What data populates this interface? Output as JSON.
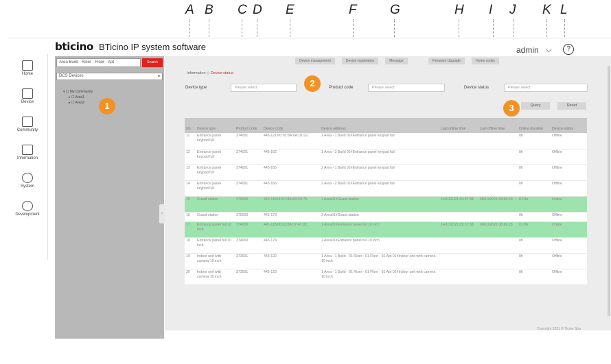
{
  "callout_letters": [
    "A",
    "B",
    "C",
    "D",
    "E",
    "F",
    "G",
    "H",
    "I",
    "J",
    "K",
    "L"
  ],
  "callout_numbers": [
    "1",
    "2",
    "3"
  ],
  "brand": {
    "logo": "bticino",
    "title": "BTicino IP system software"
  },
  "user": {
    "name": "admin",
    "chevron": "⌵",
    "help": "?"
  },
  "nav": [
    {
      "label": "Home",
      "icon": "home-icon"
    },
    {
      "label": "Device",
      "icon": "device-icon"
    },
    {
      "label": "Community",
      "icon": "community-icon"
    },
    {
      "label": "Information",
      "icon": "information-icon"
    },
    {
      "label": "System",
      "icon": "gear-icon"
    },
    {
      "label": "Development",
      "icon": "gear-icon"
    }
  ],
  "tree": {
    "search_placeholder": "Area Build - Riser - Floor - Apt",
    "search_button": "Search",
    "select_value": "DCS Devices",
    "nodes": [
      "My Community",
      "Area1",
      "Area2"
    ]
  },
  "toolbar": [
    "Device management",
    "Device registration",
    "Message",
    "Firmware Upgrade",
    "Home codes"
  ],
  "breadcrumb": {
    "parent": "Information",
    "current": "Device status"
  },
  "filters": {
    "device_type_label": "Device type",
    "device_type_value": "Please select",
    "product_code_label": "Product code",
    "product_code_value": "Please select",
    "device_status_label": "Device status",
    "device_status_value": "Please select",
    "query_button": "Query",
    "reset_button": "Reset"
  },
  "table": {
    "headers": [
      "No.",
      "Device type",
      "Product code",
      "Device code",
      "Device address",
      "Last online time",
      "Last offline time",
      "Online duration",
      "Device status"
    ],
    "rows": [
      {
        "no": "11",
        "type": "Entrance panel keypad full",
        "product": "374001",
        "code": "445-121/00:02:8A:0A:D1:02",
        "address": "1 Area - 1 Build 01#Entrance panel keypad full",
        "online": "",
        "offline": "",
        "duration": "0h",
        "status": "Offline",
        "highlight": false
      },
      {
        "no": "12",
        "type": "Entrance panel keypad full",
        "product": "374001",
        "code": "445-162",
        "address": "1 Area - 2 Build 01#Entrance panel keypad full",
        "online": "",
        "offline": "",
        "duration": "0h",
        "status": "Offline",
        "highlight": false
      },
      {
        "no": "13",
        "type": "Entrance panel keypad full",
        "product": "374001",
        "code": "445-165",
        "address": "2 Area - 1 Build 01#Entrance panel keypad full",
        "online": "",
        "offline": "",
        "duration": "0h",
        "status": "Offline",
        "highlight": false
      },
      {
        "no": "14",
        "type": "Entrance panel keypad full",
        "product": "374001",
        "code": "445-166",
        "address": "2 Area - 2 Build 01#Entrance panel keypad full",
        "online": "",
        "offline": "",
        "duration": "0h",
        "status": "Offline",
        "highlight": false
      },
      {
        "no": "15",
        "type": "Guard station",
        "product": "375000",
        "code": "445-118/00:02:8A:68:C6:76",
        "address": "1 Area01#Guard station",
        "online": "14/10/2021 09:37:38",
        "offline": "08/10/2021 08:00:29",
        "duration": "0.10h",
        "status": "Online",
        "highlight": true
      },
      {
        "no": "16",
        "type": "Guard station",
        "product": "375000",
        "code": "445-173",
        "address": "2 Area01#Guard station",
        "online": "",
        "offline": "",
        "duration": "0h",
        "status": "Offline",
        "highlight": false
      },
      {
        "no": "17",
        "type": "Entrance panel full 10 inch",
        "product": "374000",
        "code": "445-118/00:02:8A:07:41:DC",
        "address": "1 Area01#Entrance panel full 10 inch",
        "online": "14/10/2021 09:37:38",
        "offline": "08/10/2021 08:00:28",
        "duration": "0.10h",
        "status": "Online",
        "highlight": true
      },
      {
        "no": "18",
        "type": "Entrance panel full 10 inch",
        "product": "374000",
        "code": "445-174",
        "address": "2 Area01#Entrance panel full 10 inch",
        "online": "",
        "offline": "",
        "duration": "0h",
        "status": "Offline",
        "highlight": false
      },
      {
        "no": "19",
        "type": "Indoor unit with camera 10 inch",
        "product": "373001",
        "code": "445-122",
        "address": "1 Area - 1 Build - 01 Riser - 01 Floor - 01 Apt 01#Indoor unit with camera 10 inch",
        "online": "",
        "offline": "",
        "duration": "0h",
        "status": "Offline",
        "highlight": false
      },
      {
        "no": "20",
        "type": "Indoor unit with camera 10 inch",
        "product": "373001",
        "code": "445-123",
        "address": "1 Area - 1 Build - 01 Riser - 01 Floor - 01 Apt 02#Indoor unit with camera 10 inch",
        "online": "",
        "offline": "",
        "duration": "0h",
        "status": "Offline",
        "highlight": false
      }
    ]
  },
  "copyright": "Copyright 2021 © Ticino Spa"
}
